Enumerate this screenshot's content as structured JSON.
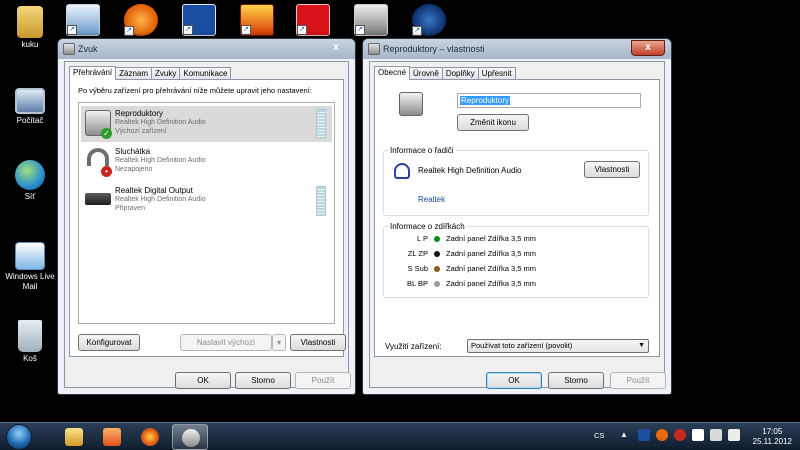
{
  "desktop": {
    "icons": [
      {
        "label": "kuku",
        "icon": "user-folder-icon"
      },
      {
        "label": "Počítač",
        "icon": "computer-icon"
      },
      {
        "label": "Síť",
        "icon": "network-globe-icon"
      },
      {
        "label": "Windows Live Mail",
        "icon": "mail-icon"
      },
      {
        "label": "Koš",
        "icon": "recycle-bin-icon"
      }
    ],
    "top_icons": [
      "control-panel-icon",
      "avast-icon",
      "zone-alarm-icon",
      "fire-app-icon",
      "pdf-reader-icon",
      "camera-app-icon",
      "hp-icon"
    ]
  },
  "sound_window": {
    "title": "Zvuk",
    "close": "x",
    "tabs": [
      {
        "label": "Přehrávání",
        "active": true
      },
      {
        "label": "Záznam",
        "active": false
      },
      {
        "label": "Zvuky",
        "active": false
      },
      {
        "label": "Komunikace",
        "active": false
      }
    ],
    "intro": "Po výběru zařízení pro přehrávání níže můžete upravit jeho nastavení:",
    "devices": [
      {
        "name": "Reproduktory",
        "driver": "Realtek High Definition Audio",
        "status": "Výchozí zařízení",
        "icon": "speaker-icon",
        "selected": true
      },
      {
        "name": "Sluchátka",
        "driver": "Realtek High Definition Audio",
        "status": "Nezapojeno",
        "icon": "headphones-icon",
        "selected": false
      },
      {
        "name": "Realtek Digital Output",
        "driver": "Realtek High Definition Audio",
        "status": "Připraven",
        "icon": "digital-output-icon",
        "selected": false
      }
    ],
    "buttons": {
      "configure": "Konfigurovat",
      "set_default": "Nastavit výchozí",
      "properties": "Vlastnosti",
      "ok": "OK",
      "cancel": "Storno",
      "apply": "Použít"
    }
  },
  "props_window": {
    "title": "Reproduktory – vlastnosti",
    "close": "x",
    "tabs": [
      {
        "label": "Obecné",
        "active": true
      },
      {
        "label": "Úrovně",
        "active": false
      },
      {
        "label": "Doplňky",
        "active": false
      },
      {
        "label": "Upřesnit",
        "active": false
      }
    ],
    "device_name": "Reproduktory",
    "change_icon": "Změnit ikonu",
    "controller": {
      "label": "Informace o řadiči",
      "name": "Realtek High Definition Audio",
      "properties": "Vlastnosti",
      "vendor": "Realtek"
    },
    "jacks": {
      "label": "Informace o zdířkách",
      "rows": [
        {
          "code": "L P",
          "text": "Zadní panel Zdířka 3,5 mm",
          "color": "#0d8a1e"
        },
        {
          "code": "ZL ZP",
          "text": "Zadní panel Zdířka 3,5 mm",
          "color": "#111111"
        },
        {
          "code": "S Sub",
          "text": "Zadní panel Zdířka 3,5 mm",
          "color": "#8a5a1c"
        },
        {
          "code": "BL BP",
          "text": "Zadní panel Zdířka 3,5 mm",
          "color": "#9a9a9a"
        }
      ]
    },
    "usage_label": "Využití zařízení:",
    "usage_value": "Používat toto zařízení (povolit)",
    "buttons": {
      "ok": "OK",
      "cancel": "Storno",
      "apply": "Použít"
    }
  },
  "taskbar": {
    "items": [
      "explorer-icon",
      "media-player-icon",
      "firefox-icon",
      "sound-settings-icon"
    ],
    "language": "CS",
    "time": "17:05",
    "date": "25.11.2012"
  }
}
